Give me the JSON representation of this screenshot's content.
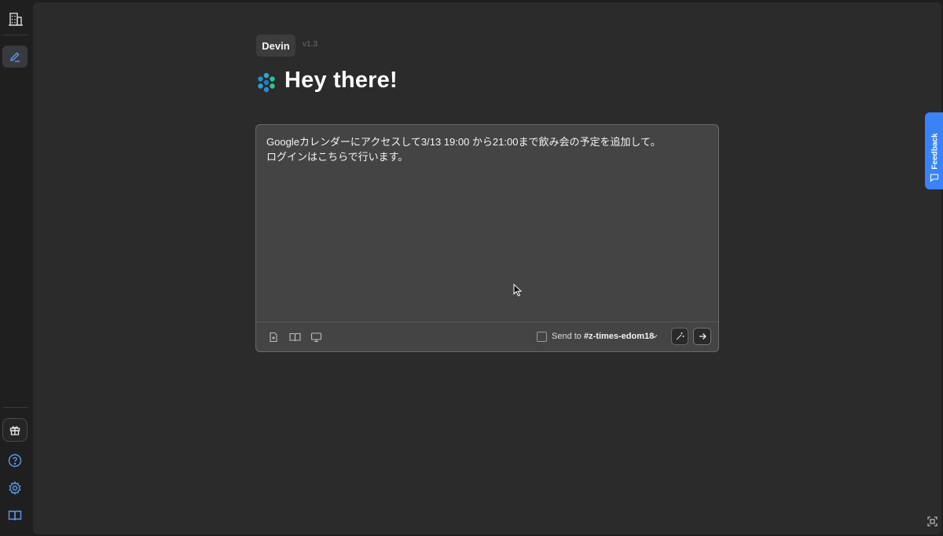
{
  "sidebar": {
    "icons": [
      "building-icon",
      "compose-icon",
      "gift-icon",
      "help-icon",
      "gear-icon",
      "book-icon"
    ]
  },
  "header": {
    "tab_label": "Devin",
    "version": "v1.3",
    "greeting": "Hey there!"
  },
  "composer": {
    "text": "Googleカレンダーにアクセスして3/13 19:00 から21:00まで飲み会の予定を追加して。\nログインはこちらで行います。",
    "send_to_label": "Send to",
    "channel": "#z-times-edom18"
  },
  "feedback": {
    "label": "Feedback"
  },
  "colors": {
    "accent": "#3b82f6",
    "sidebar_icon": "#5b9bf0",
    "background": "#2b2b2b",
    "composer_bg": "#444444"
  }
}
